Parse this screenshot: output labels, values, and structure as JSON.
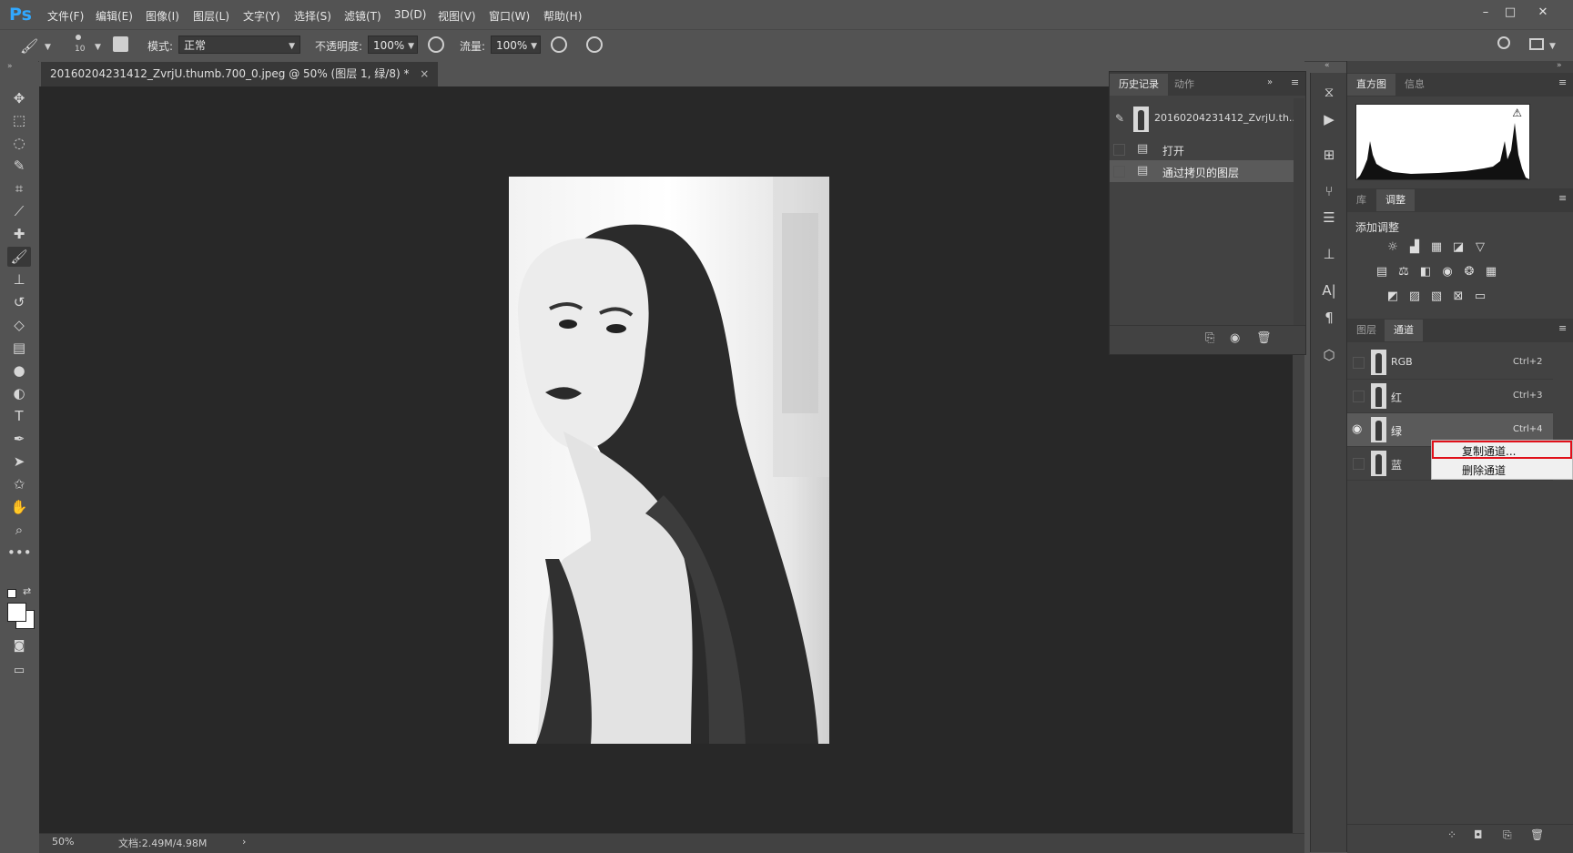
{
  "app": {
    "logo": "Ps",
    "menus": [
      "文件(F)",
      "编辑(E)",
      "图像(I)",
      "图层(L)",
      "文字(Y)",
      "选择(S)",
      "滤镜(T)",
      "3D(D)",
      "视图(V)",
      "窗口(W)",
      "帮助(H)"
    ],
    "window_controls": [
      "–",
      "□",
      "✕"
    ]
  },
  "options": {
    "brush_size": "10",
    "mode_label": "模式:",
    "mode_value": "正常",
    "opacity_label": "不透明度:",
    "opacity_value": "100%",
    "flow_label": "流量:",
    "flow_value": "100%"
  },
  "document": {
    "tab_title": "20160204231412_ZvrjU.thumb.700_0.jpeg @ 50% (图层 1, 绿/8) *",
    "tab_close": "×",
    "zoom": "50%",
    "doc_info": "文档:2.49M/4.98M",
    "status_arrow": "›"
  },
  "history": {
    "tabs": [
      "历史记录",
      "动作"
    ],
    "snapshot_label": "20160204231412_ZvrjU.th...",
    "items": [
      "打开",
      "通过拷贝的图层"
    ],
    "selected_index": 1
  },
  "histogram_panel": {
    "tabs": [
      "直方图",
      "信息"
    ],
    "warning": "⚠"
  },
  "adjust_panel": {
    "tabs": [
      "库",
      "调整"
    ],
    "title": "添加调整",
    "row1_icons": [
      "brightness-icon",
      "levels-icon",
      "curves-icon",
      "exposure-icon",
      "vibrance-icon"
    ],
    "row2_icons": [
      "hue-saturation-icon",
      "color-balance-icon",
      "black-white-icon",
      "photo-filter-icon",
      "channel-mixer-icon",
      "color-lookup-icon"
    ],
    "row3_icons": [
      "invert-icon",
      "posterize-icon",
      "threshold-icon",
      "selective-color-icon",
      "gradient-map-icon"
    ]
  },
  "channels_panel": {
    "tabs": [
      "图层",
      "通道"
    ],
    "channels": [
      {
        "name": "RGB",
        "shortcut": "Ctrl+2"
      },
      {
        "name": "红",
        "shortcut": "Ctrl+3"
      },
      {
        "name": "绿",
        "shortcut": "Ctrl+4"
      },
      {
        "name": "蓝",
        "shortcut": ""
      }
    ],
    "selected_index": 2
  },
  "context_menu": {
    "items": [
      "复制通道...",
      "删除通道"
    ]
  },
  "colors": {
    "ui_bg": "#535353",
    "panel_bg": "#424242",
    "canvas_bg": "#282828",
    "ps_blue": "#31a8ff",
    "highlight_red": "#e0101a"
  }
}
